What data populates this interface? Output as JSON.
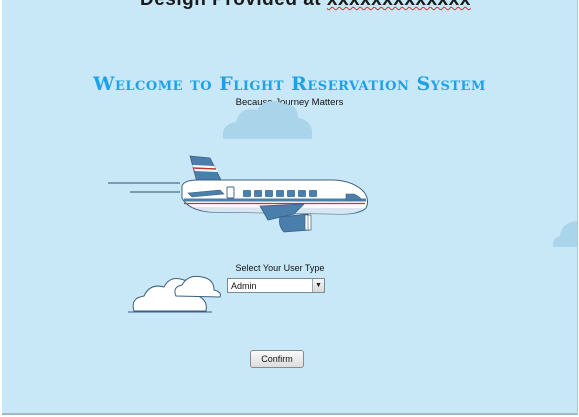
{
  "header": {
    "clipped_text": "Design Provided at",
    "squiggle_text": "xxxxxxxxxxxxx"
  },
  "page": {
    "title": "Welcome to Flight Reservation System",
    "subtitle": "Because Journey Matters"
  },
  "form": {
    "user_type_label": "Select Your User Type",
    "user_type_selected": "Admin",
    "confirm_label": "Confirm"
  },
  "icons": {
    "plane": "airplane-illustration",
    "clouds": "cloud-icon",
    "dropdown": "chevron-down-icon"
  },
  "colors": {
    "background": "#c9e8f7",
    "title": "#1ea1e6",
    "plane_body": "#ffffff",
    "plane_accent": "#4a7fab",
    "stripe": "#c0392b"
  }
}
